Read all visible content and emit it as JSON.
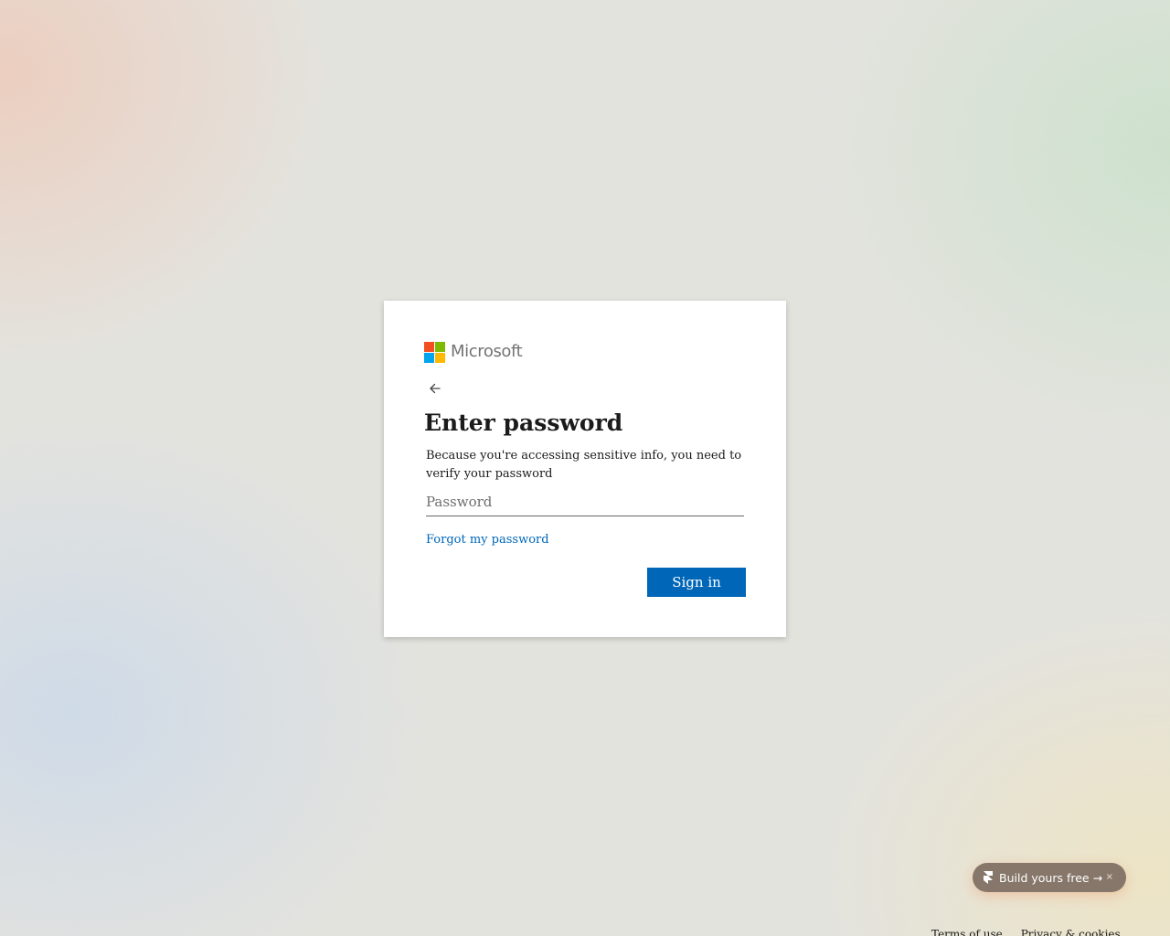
{
  "brand": {
    "name": "Microsoft",
    "logo_colors": [
      "#f25022",
      "#7fba00",
      "#00a4ef",
      "#ffb900"
    ]
  },
  "signin_card": {
    "back_icon": "arrow-left-icon",
    "title": "Enter password",
    "description": "Because you're accessing sensitive info, you need to verify your password",
    "password_field": {
      "placeholder": "Password",
      "value": ""
    },
    "forgot_link": "Forgot my password",
    "submit_label": "Sign in",
    "accent_color": "#0067b8"
  },
  "promo_badge": {
    "label": "Build yours free →",
    "close_label": "×",
    "icon": "framer-logo-icon"
  },
  "footer": {
    "links": [
      "Terms of use",
      "Privacy & cookies"
    ]
  }
}
